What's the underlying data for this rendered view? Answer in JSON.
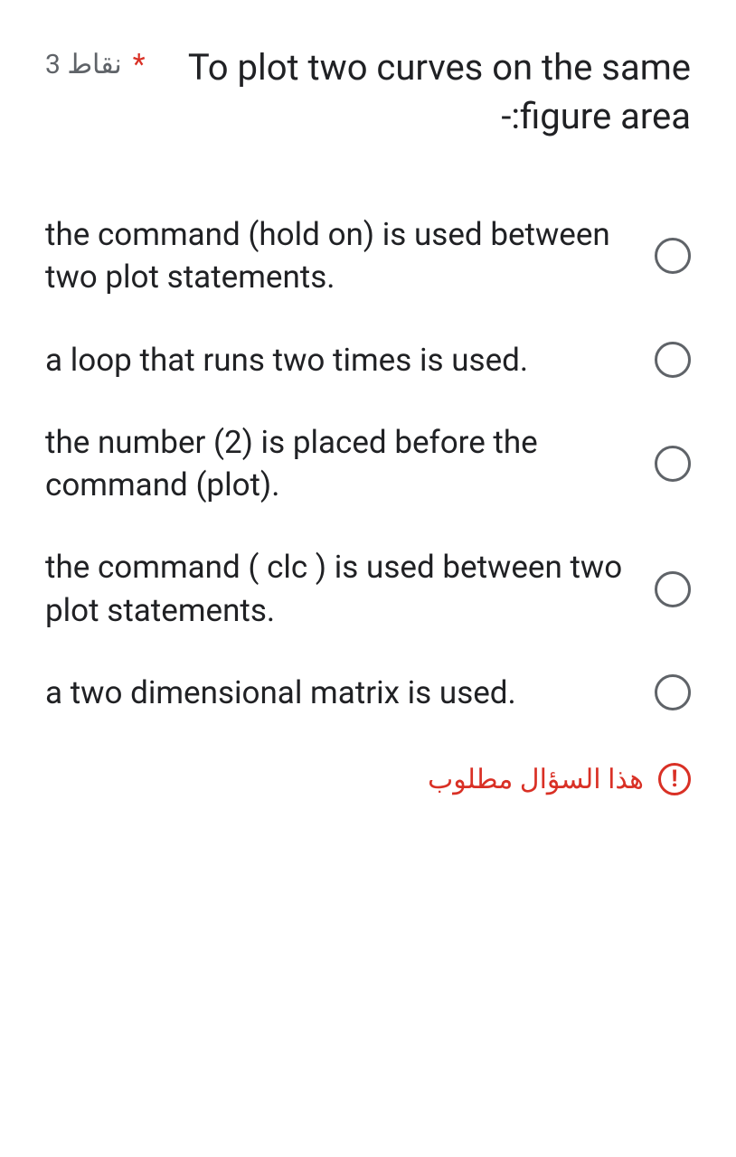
{
  "question": {
    "points_label": "3 نقاط",
    "required_mark": "*",
    "text": "To plot two curves on the same figure area:-"
  },
  "options": [
    {
      "label": "the command (hold on) is used between two plot statements."
    },
    {
      "label": "a loop that runs two times is used."
    },
    {
      "label": "the number (2) is placed before the command (plot)."
    },
    {
      "label": "the command ( clc ) is used between two plot statements."
    },
    {
      "label": "a two dimensional matrix is used."
    }
  ],
  "error": {
    "text": "هذا السؤال مطلوب",
    "icon_glyph": "!"
  }
}
